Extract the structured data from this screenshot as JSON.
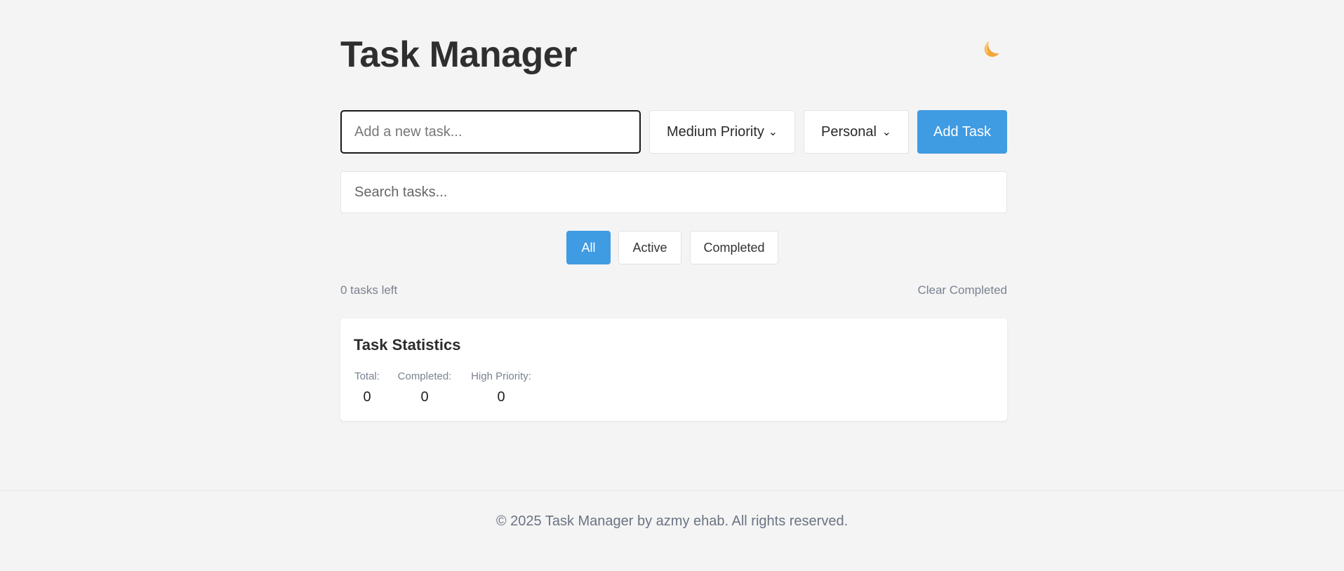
{
  "header": {
    "title": "Task Manager",
    "theme_toggle_icon": "crescent-moon-icon"
  },
  "form": {
    "task_placeholder": "Add a new task...",
    "task_value": "",
    "priority_selected": "Medium Priority",
    "category_selected": "Personal",
    "add_button_label": "Add Task"
  },
  "search": {
    "placeholder": "Search tasks...",
    "value": ""
  },
  "filters": {
    "items": [
      {
        "label": "All",
        "active": true
      },
      {
        "label": "Active",
        "active": false
      },
      {
        "label": "Completed",
        "active": false
      }
    ]
  },
  "summary": {
    "tasks_left": "0 tasks left",
    "clear_completed_label": "Clear Completed"
  },
  "stats": {
    "title": "Task Statistics",
    "total_label": "Total:",
    "total_value": "0",
    "completed_label": "Completed:",
    "completed_value": "0",
    "high_priority_label": "High Priority:",
    "high_priority_value": "0"
  },
  "footer": {
    "text": "© 2025 Task Manager by azmy ehab. All rights reserved."
  },
  "colors": {
    "accent": "#3f9be2",
    "background": "#f4f4f4",
    "muted_text": "#7a8291"
  }
}
